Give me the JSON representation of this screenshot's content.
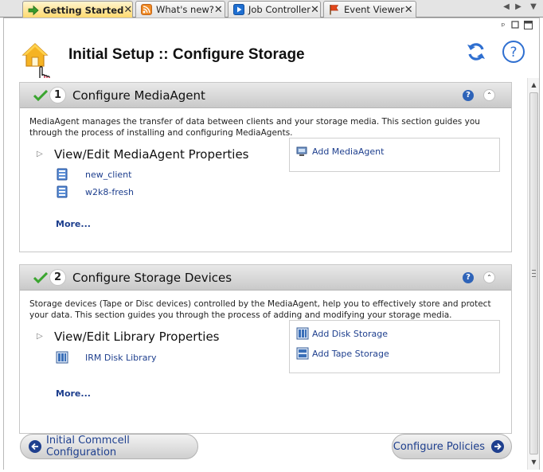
{
  "tabs": [
    {
      "label": "Getting Started",
      "icon": "arrow-right-icon",
      "active": true
    },
    {
      "label": "What's new?",
      "icon": "rss-icon",
      "active": false
    },
    {
      "label": "Job Controller",
      "icon": "play-icon",
      "active": false
    },
    {
      "label": "Event Viewer",
      "icon": "flag-icon",
      "active": false
    }
  ],
  "tab_close_glyph": "✕",
  "header": {
    "title": "Initial Setup :: Configure Storage",
    "help_glyph": "?"
  },
  "sections": [
    {
      "number": "1",
      "title": "Configure MediaAgent",
      "description": "MediaAgent manages the transfer of data between clients and your storage media. This section guides you through the process of installing and configuring MediaAgents.",
      "subtitle": "View/Edit MediaAgent Properties",
      "items": [
        "new_client",
        "w2k8-fresh"
      ],
      "more": "More...",
      "actions": [
        "Add MediaAgent"
      ]
    },
    {
      "number": "2",
      "title": "Configure Storage Devices",
      "description": "Storage devices (Tape or Disc devices) controlled by the MediaAgent, help you to effectively store and protect your data. This section guides you through the process of adding and modifying your storage media.",
      "subtitle": "View/Edit Library Properties",
      "items": [
        "IRM Disk Library"
      ],
      "more": "More...",
      "actions": [
        "Add Disk Storage",
        "Add Tape Storage"
      ]
    }
  ],
  "section_help_glyph": "?",
  "section_collapse_glyph": "⌃",
  "footer": {
    "back_label": "Initial Commcell Configuration",
    "next_label": "Configure Policies"
  },
  "colors": {
    "active_tab": "#ffd86b",
    "link": "#1e3f8e",
    "check": "#3aa52f",
    "accent_blue": "#2e63b8"
  }
}
